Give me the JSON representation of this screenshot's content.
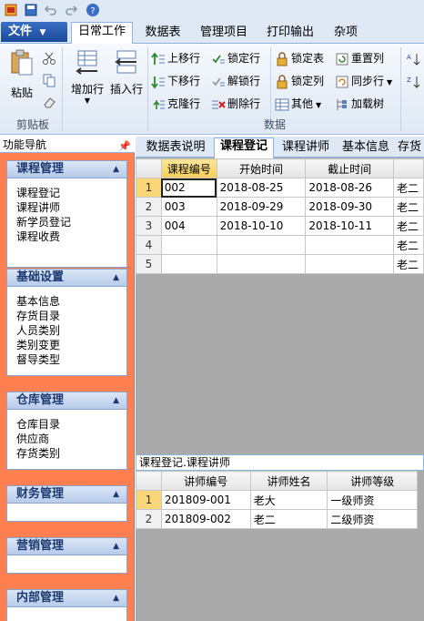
{
  "quick_access": {
    "icons": [
      "app-icon",
      "save-icon",
      "undo-icon",
      "redo-icon",
      "help-icon"
    ]
  },
  "file_button": {
    "label": "文件"
  },
  "ribbon_tabs": [
    "日常工作",
    "数据表",
    "管理项目",
    "打印输出",
    "杂项"
  ],
  "ribbon": {
    "clipboard": {
      "paste": "粘贴",
      "group_label": "剪贴板"
    },
    "data": {
      "add_row": "增加行",
      "insert_row": "插入行",
      "move_up": "上移行",
      "move_down": "下移行",
      "clone_row": "克隆行",
      "lock_row": "锁定行",
      "unlock_row": "解锁行",
      "delete_row": "删除行",
      "lock_table": "锁定表",
      "lock_column": "锁定列",
      "other": "其他",
      "reset_column": "重置列",
      "sync_row": "同步行",
      "load_tree": "加载树",
      "group_label": "数据"
    }
  },
  "nav": {
    "title": "功能导航",
    "groups": [
      {
        "title": "课程管理",
        "items": [
          "课程登记",
          "课程讲师",
          "新学员登记",
          "课程收费"
        ]
      },
      {
        "title": "基础设置",
        "items": [
          "基本信息",
          "存货目录",
          "人员类别",
          "类别变更",
          "督导类型"
        ]
      },
      {
        "title": "仓库管理",
        "items": [
          "仓库目录",
          "供应商",
          "存货类别"
        ]
      },
      {
        "title": "财务管理",
        "items": []
      },
      {
        "title": "营销管理",
        "items": []
      },
      {
        "title": "内部管理",
        "items": []
      }
    ]
  },
  "doc_tabs": [
    "数据表说明",
    "课程登记",
    "课程讲师",
    "基本信息",
    "存货"
  ],
  "main_grid": {
    "columns": [
      "课程编号",
      "开始时间",
      "截止时间",
      ""
    ],
    "rows": [
      {
        "no": "1",
        "cells": [
          "002",
          "2018-08-25",
          "2018-08-26",
          "老二"
        ]
      },
      {
        "no": "2",
        "cells": [
          "003",
          "2018-09-29",
          "2018-09-30",
          "老二"
        ]
      },
      {
        "no": "3",
        "cells": [
          "004",
          "2018-10-10",
          "2018-10-11",
          "老二"
        ]
      },
      {
        "no": "4",
        "cells": [
          "",
          "",
          "",
          "老二"
        ]
      },
      {
        "no": "5",
        "cells": [
          "",
          "",
          "",
          "老二"
        ]
      }
    ]
  },
  "detail": {
    "caption": "课程登记.课程讲师",
    "columns": [
      "讲师编号",
      "讲师姓名",
      "讲师等级"
    ],
    "rows": [
      {
        "no": "1",
        "cells": [
          "201809-001",
          "老大",
          "一级师资"
        ]
      },
      {
        "no": "2",
        "cells": [
          "201809-002",
          "老二",
          "二级师资"
        ]
      }
    ]
  },
  "colors": {
    "nav_bg": "#ff7f50",
    "ribbon_border": "#8db2e3",
    "selected_header": "#f7cf5a",
    "grid_bg": "#aaaaaa"
  }
}
